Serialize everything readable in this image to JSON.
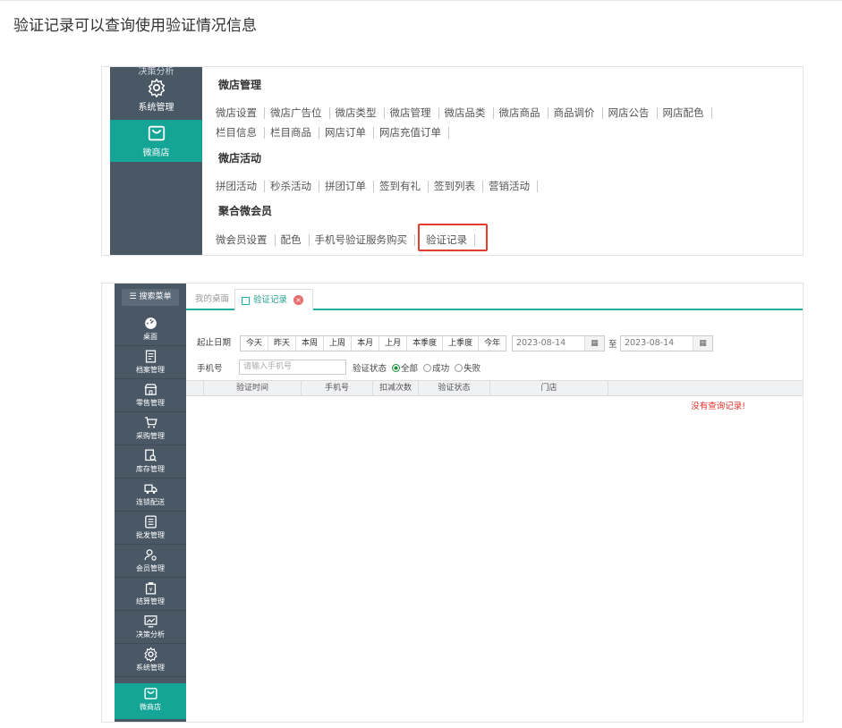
{
  "caption": "验证记录可以查询使用验证情况信息",
  "shot1": {
    "sidebar_cut": "决策分析",
    "sidebar": [
      {
        "label": "系统管理",
        "icon": "gear-icon"
      },
      {
        "label": "微商店",
        "icon": "shop-bag-icon"
      }
    ],
    "sections": [
      {
        "title": "微店管理",
        "rows": [
          [
            "微店设置",
            "微店广告位",
            "微店类型",
            "微店管理",
            "微店品类",
            "微店商品",
            "商品调价",
            "网店公告",
            "网店配色"
          ],
          [
            "栏目信息",
            "栏目商品",
            "网店订单",
            "网店充值订单"
          ]
        ]
      },
      {
        "title": "微店活动",
        "rows": [
          [
            "拼团活动",
            "秒杀活动",
            "拼团订单",
            "签到有礼",
            "签到列表",
            "营销活动"
          ]
        ]
      },
      {
        "title": "聚合微会员",
        "rows": [
          [
            "微会员设置",
            "配色",
            "手机号验证服务购买",
            "验证记录"
          ]
        ]
      }
    ],
    "highlight_color": "#e23d2f"
  },
  "shot2": {
    "search_menu": "搜索菜单",
    "sidebar": [
      {
        "label": "桌面",
        "icon": "dashboard-icon"
      },
      {
        "label": "档案管理",
        "icon": "file-icon"
      },
      {
        "label": "零售管理",
        "icon": "store-icon"
      },
      {
        "label": "采购管理",
        "icon": "cart-icon"
      },
      {
        "label": "库存管理",
        "icon": "inventory-search-icon"
      },
      {
        "label": "连锁配送",
        "icon": "truck-icon"
      },
      {
        "label": "批发管理",
        "icon": "wholesale-icon"
      },
      {
        "label": "会员管理",
        "icon": "member-icon"
      },
      {
        "label": "结算管理",
        "icon": "wallet-icon"
      },
      {
        "label": "决策分析",
        "icon": "chart-icon"
      },
      {
        "label": "系统管理",
        "icon": "gear-icon"
      },
      {
        "label": "微商店",
        "icon": "shop-bag-icon"
      }
    ],
    "tabs": {
      "home": "我的桌面",
      "current": "验证记录"
    },
    "filter": {
      "date_label": "起止日期",
      "quick_buttons": [
        "今天",
        "昨天",
        "本周",
        "上周",
        "本月",
        "上月",
        "本季度",
        "上季度",
        "今年"
      ],
      "date_from": "2023-08-14",
      "date_to": "2023-08-14",
      "date_sep": "至",
      "phone_label": "手机号",
      "phone_placeholder": "请输入手机号",
      "status_label": "验证状态",
      "status_options": [
        "全部",
        "成功",
        "失败"
      ],
      "status_selected": "全部"
    },
    "table": {
      "columns": [
        "验证时间",
        "手机号",
        "扣减次数",
        "验证状态",
        "门店"
      ],
      "empty_text": "没有查询记录!"
    },
    "accent_color": "#14a596",
    "sidebar_color": "#4a5866"
  }
}
